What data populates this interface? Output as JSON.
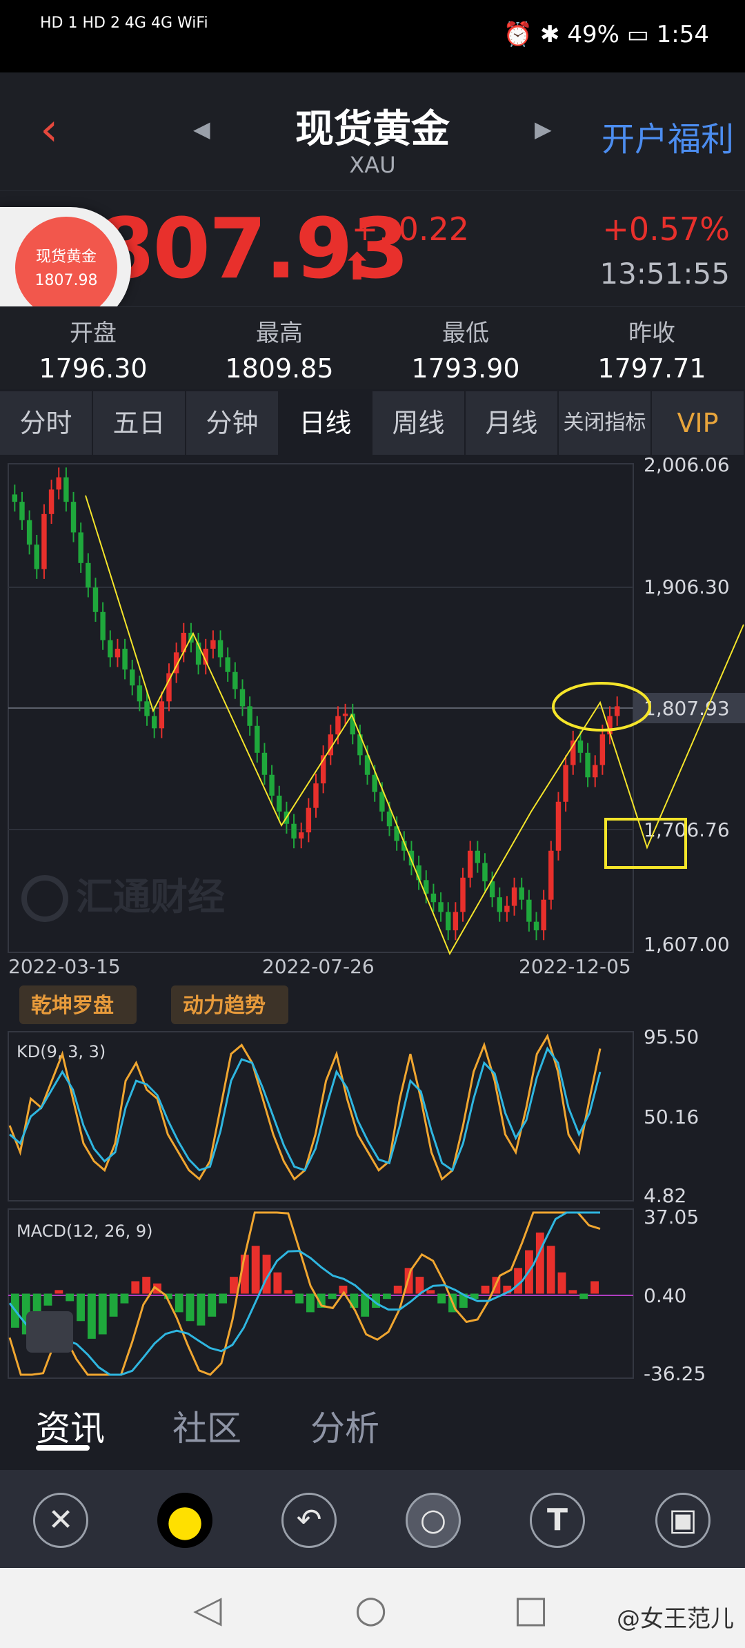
{
  "status_bar": {
    "left_text": "HD 1 HD 2 4G 4G WiFi",
    "right_text": "⏰ ✱ 49% ▭ 1:54"
  },
  "header": {
    "back_label": "‹",
    "title": "现货黄金",
    "subtitle": "XAU",
    "prev_label": "◀",
    "next_label": "▶",
    "promo": "开户福利"
  },
  "quote": {
    "price": "1807.93",
    "price_display": "807.93",
    "change": "+10.22",
    "change_pct": "+0.57%",
    "time": "13:51:55",
    "up_arrow": "⬆",
    "accent": "#e8302c"
  },
  "bubble": {
    "title": "现货黄金",
    "price": "1807.98"
  },
  "stats": [
    {
      "label": "开盘",
      "value": "1796.30"
    },
    {
      "label": "最高",
      "value": "1809.85"
    },
    {
      "label": "最低",
      "value": "1793.90"
    },
    {
      "label": "昨收",
      "value": "1797.71"
    }
  ],
  "tabs": [
    "分时",
    "五日",
    "分钟",
    "日线",
    "周线",
    "月线",
    "关闭指标",
    "VIP"
  ],
  "active_tab": "日线",
  "chart_data": {
    "type": "candlestick",
    "main": {
      "y_ticks": [
        "2,006.06",
        "1,906.30",
        "1,807.93",
        "1,706.76",
        "1,607.00"
      ],
      "ylim": [
        1607.0,
        2006.06
      ],
      "current_price_line": 1807.93,
      "x_ticks": [
        "2022-03-15",
        "2022-07-26",
        "2022-12-05"
      ],
      "watermark": "汇通财经",
      "close_series": [
        1975,
        1960,
        1940,
        1920,
        1965,
        1985,
        1995,
        1975,
        1950,
        1925,
        1905,
        1885,
        1862,
        1848,
        1855,
        1838,
        1825,
        1812,
        1800,
        1790,
        1812,
        1835,
        1852,
        1868,
        1860,
        1842,
        1855,
        1862,
        1848,
        1836,
        1822,
        1808,
        1792,
        1770,
        1752,
        1735,
        1722,
        1712,
        1700,
        1705,
        1725,
        1745,
        1768,
        1785,
        1800,
        1802,
        1785,
        1768,
        1752,
        1738,
        1722,
        1710,
        1698,
        1690,
        1678,
        1666,
        1655,
        1648,
        1640,
        1625,
        1640,
        1668,
        1690,
        1680,
        1665,
        1652,
        1640,
        1645,
        1660,
        1650,
        1632,
        1625,
        1650,
        1690,
        1730,
        1760,
        1780,
        1770,
        1750,
        1760,
        1785,
        1800,
        1808
      ]
    },
    "kd": {
      "label": "KD(9, 3, 3)",
      "y_ticks": [
        "95.50",
        "50.16",
        "4.82"
      ],
      "ylim": [
        4.82,
        95.5
      ],
      "k": [
        45,
        30,
        60,
        55,
        70,
        85,
        60,
        35,
        25,
        20,
        35,
        70,
        80,
        65,
        60,
        40,
        30,
        20,
        15,
        25,
        55,
        85,
        90,
        80,
        60,
        40,
        25,
        15,
        20,
        40,
        70,
        85,
        60,
        40,
        30,
        20,
        25,
        60,
        85,
        60,
        30,
        15,
        20,
        45,
        75,
        90,
        70,
        40,
        30,
        55,
        85,
        95,
        75,
        40,
        30,
        60,
        88
      ],
      "d": [
        40,
        35,
        50,
        55,
        65,
        75,
        65,
        45,
        32,
        25,
        30,
        55,
        70,
        68,
        62,
        48,
        36,
        26,
        20,
        22,
        42,
        70,
        82,
        80,
        66,
        50,
        34,
        22,
        20,
        32,
        55,
        75,
        66,
        48,
        36,
        26,
        24,
        45,
        70,
        64,
        42,
        24,
        20,
        35,
        60,
        80,
        74,
        52,
        38,
        48,
        72,
        88,
        80,
        55,
        40,
        52,
        75
      ]
    },
    "macd": {
      "label": "MACD(12, 26, 9)",
      "y_ticks": [
        "37.05",
        "0.40",
        "-36.25"
      ],
      "ylim": [
        -36.25,
        37.05
      ],
      "hist": [
        -15,
        -18,
        -12,
        -5,
        2,
        -3,
        -12,
        -20,
        -18,
        -10,
        -4,
        6,
        8,
        5,
        -2,
        -8,
        -12,
        -14,
        -10,
        -4,
        8,
        18,
        22,
        18,
        10,
        2,
        -4,
        -8,
        -6,
        -2,
        4,
        -6,
        -10,
        -6,
        -2,
        4,
        12,
        8,
        2,
        -4,
        -8,
        -6,
        -2,
        4,
        8,
        4,
        12,
        20,
        28,
        22,
        10,
        2,
        -2,
        6
      ]
    }
  },
  "indicator_buttons": [
    "乾坤罗盘",
    "动力趋势"
  ],
  "bottom_tabs": [
    "资讯",
    "社区",
    "分析"
  ],
  "toolbar": {
    "close_label": "✕",
    "color_label": "●",
    "undo_label": "↶",
    "circle_label": "○",
    "text_label": "T",
    "save_label": "▣",
    "highlight_color": "#ffe000"
  },
  "navbar": {
    "back_label": "◁",
    "home_label": "○",
    "recent_label": "□",
    "watermark": "@女王范儿"
  }
}
